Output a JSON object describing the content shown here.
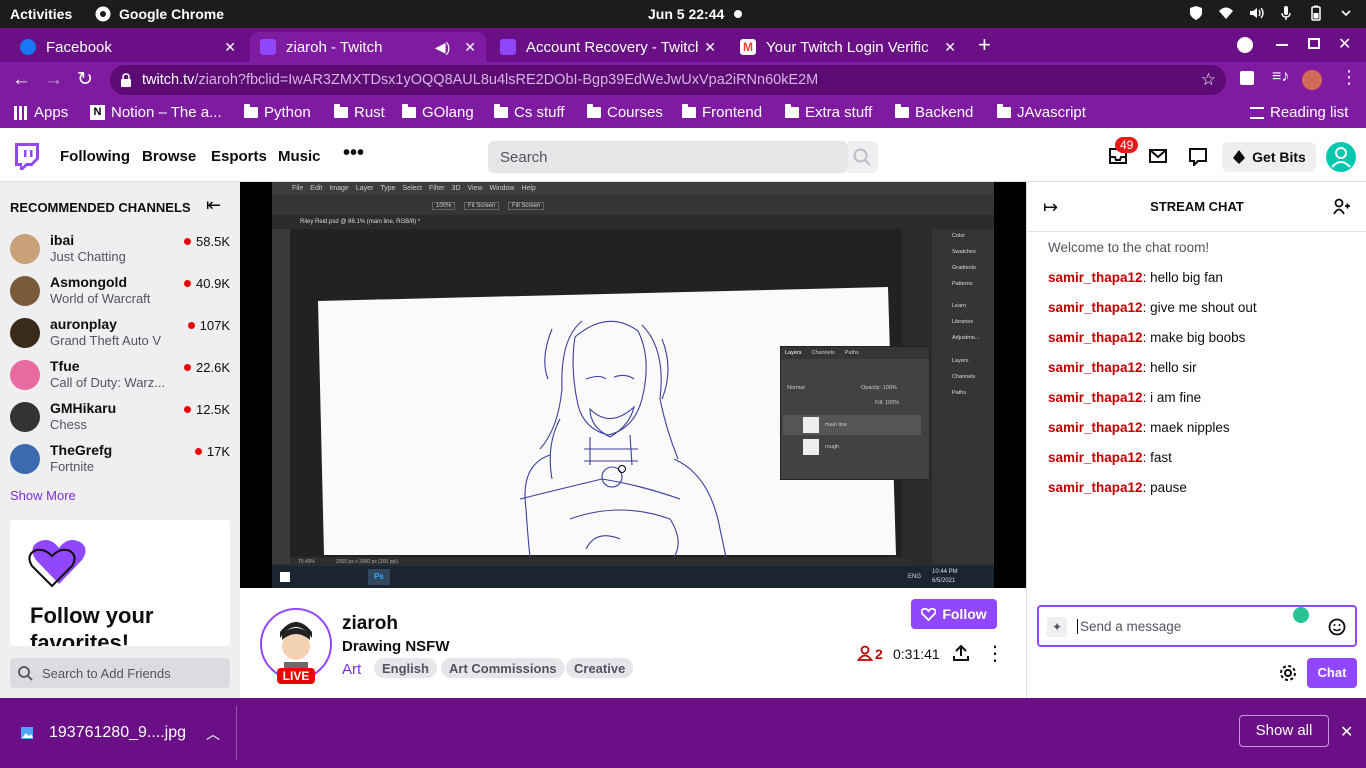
{
  "os": {
    "activities": "Activities",
    "app_name": "Google Chrome",
    "clock": "Jun 5  22:44"
  },
  "tabs": [
    {
      "title": "Facebook",
      "fav_color": "#1877f2"
    },
    {
      "title": "ziaroh - Twitch",
      "fav_color": "#9146ff"
    },
    {
      "title": "Account Recovery - Twitch",
      "fav_color": "#9146ff"
    },
    {
      "title": "Your Twitch Login Verific",
      "fav_color": "#ea4335"
    }
  ],
  "url": {
    "host": "twitch.tv",
    "path": "/ziaroh?fbclid=IwAR3ZMXTDsx1yOQQ8AUL8u4lsRE2DObI-Bgp39EdWeJwUxVpa2iRNn60kE2M"
  },
  "bookmarks": [
    "Apps",
    "Notion – The a...",
    "Python",
    "Rust",
    "GOlang",
    "Cs stuff",
    "Courses",
    "Frontend",
    "Extra stuff",
    "Backend",
    "JAvascript"
  ],
  "reading_list": "Reading list",
  "twitch_nav": {
    "links": [
      "Following",
      "Browse",
      "Esports",
      "Music"
    ],
    "search_placeholder": "Search",
    "notif_count": "49",
    "get_bits": "Get Bits"
  },
  "sidebar": {
    "header": "RECOMMENDED CHANNELS",
    "channels": [
      {
        "name": "ibai",
        "game": "Just Chatting",
        "viewers": "58.5K",
        "color": "#c9a27a"
      },
      {
        "name": "Asmongold",
        "game": "World of Warcraft",
        "viewers": "40.9K",
        "color": "#7a5a3a"
      },
      {
        "name": "auronplay",
        "game": "Grand Theft Auto V",
        "viewers": "107K",
        "color": "#3a2a1a"
      },
      {
        "name": "Tfue",
        "game": "Call of Duty: Warz...",
        "viewers": "22.6K",
        "color": "#e86aa0"
      },
      {
        "name": "GMHikaru",
        "game": "Chess",
        "viewers": "12.5K",
        "color": "#333333"
      },
      {
        "name": "TheGrefg",
        "game": "Fortnite",
        "viewers": "17K",
        "color": "#3a6ab0"
      }
    ],
    "show_more": "Show More",
    "promo_title": "Follow your favorites!",
    "friends_search": "Search to Add Friends"
  },
  "photoshop": {
    "menus": [
      "File",
      "Edit",
      "Image",
      "Layer",
      "Type",
      "Select",
      "Filter",
      "3D",
      "View",
      "Window",
      "Help"
    ],
    "doc_tab": "Riley Reid.psd @ 86.1% (main line, RGB/8) *",
    "zoom_btns": [
      "100%",
      "Fit Screen",
      "Fill Screen"
    ],
    "status": "75.49%",
    "doc_size": "2000 px x 2000 px (300 ppi)",
    "panels": [
      "Color",
      "Swatches",
      "Gradients",
      "Patterns",
      "Learn",
      "Libraries",
      "Adjustme...",
      "Layers",
      "Channels",
      "Paths"
    ],
    "layers_tabs": [
      "Layers",
      "Channels",
      "Paths"
    ],
    "blend": "Normal",
    "opacity": "Opacity: 100%",
    "fill": "Fill: 100%",
    "layers": [
      "main line",
      "rough"
    ],
    "taskbar_time": "10:44 PM",
    "taskbar_date": "6/5/2021",
    "taskbar_lang": "ENG"
  },
  "stream": {
    "channel": "ziaroh",
    "title": "Drawing NSFW",
    "category": "Art",
    "tags": [
      "English",
      "Art Commissions",
      "Creative"
    ],
    "live": "LIVE",
    "viewers": "2",
    "uptime": "0:31:41",
    "follow": "Follow"
  },
  "chat": {
    "header": "STREAM CHAT",
    "welcome": "Welcome to the chat room!",
    "messages": [
      {
        "user": "samir_thapa12",
        "text": ": hello big fan"
      },
      {
        "user": "samir_thapa12",
        "text": ": give me shout out"
      },
      {
        "user": "samir_thapa12",
        "text": ": make big boobs"
      },
      {
        "user": "samir_thapa12",
        "text": ": hello sir"
      },
      {
        "user": "samir_thapa12",
        "text": ": i am fine"
      },
      {
        "user": "samir_thapa12",
        "text": ": maek nipples"
      },
      {
        "user": "samir_thapa12",
        "text": ": fast"
      },
      {
        "user": "samir_thapa12",
        "text": ": pause"
      }
    ],
    "placeholder": "Send a message",
    "send": "Chat"
  },
  "downloads": {
    "file": "193761280_9....jpg",
    "show_all": "Show all"
  },
  "colors": {
    "twitch_purple": "#9147ff",
    "chrome_frame": "#7f1ba0",
    "live_red": "#eb0400",
    "chat_user": "#c00000"
  }
}
